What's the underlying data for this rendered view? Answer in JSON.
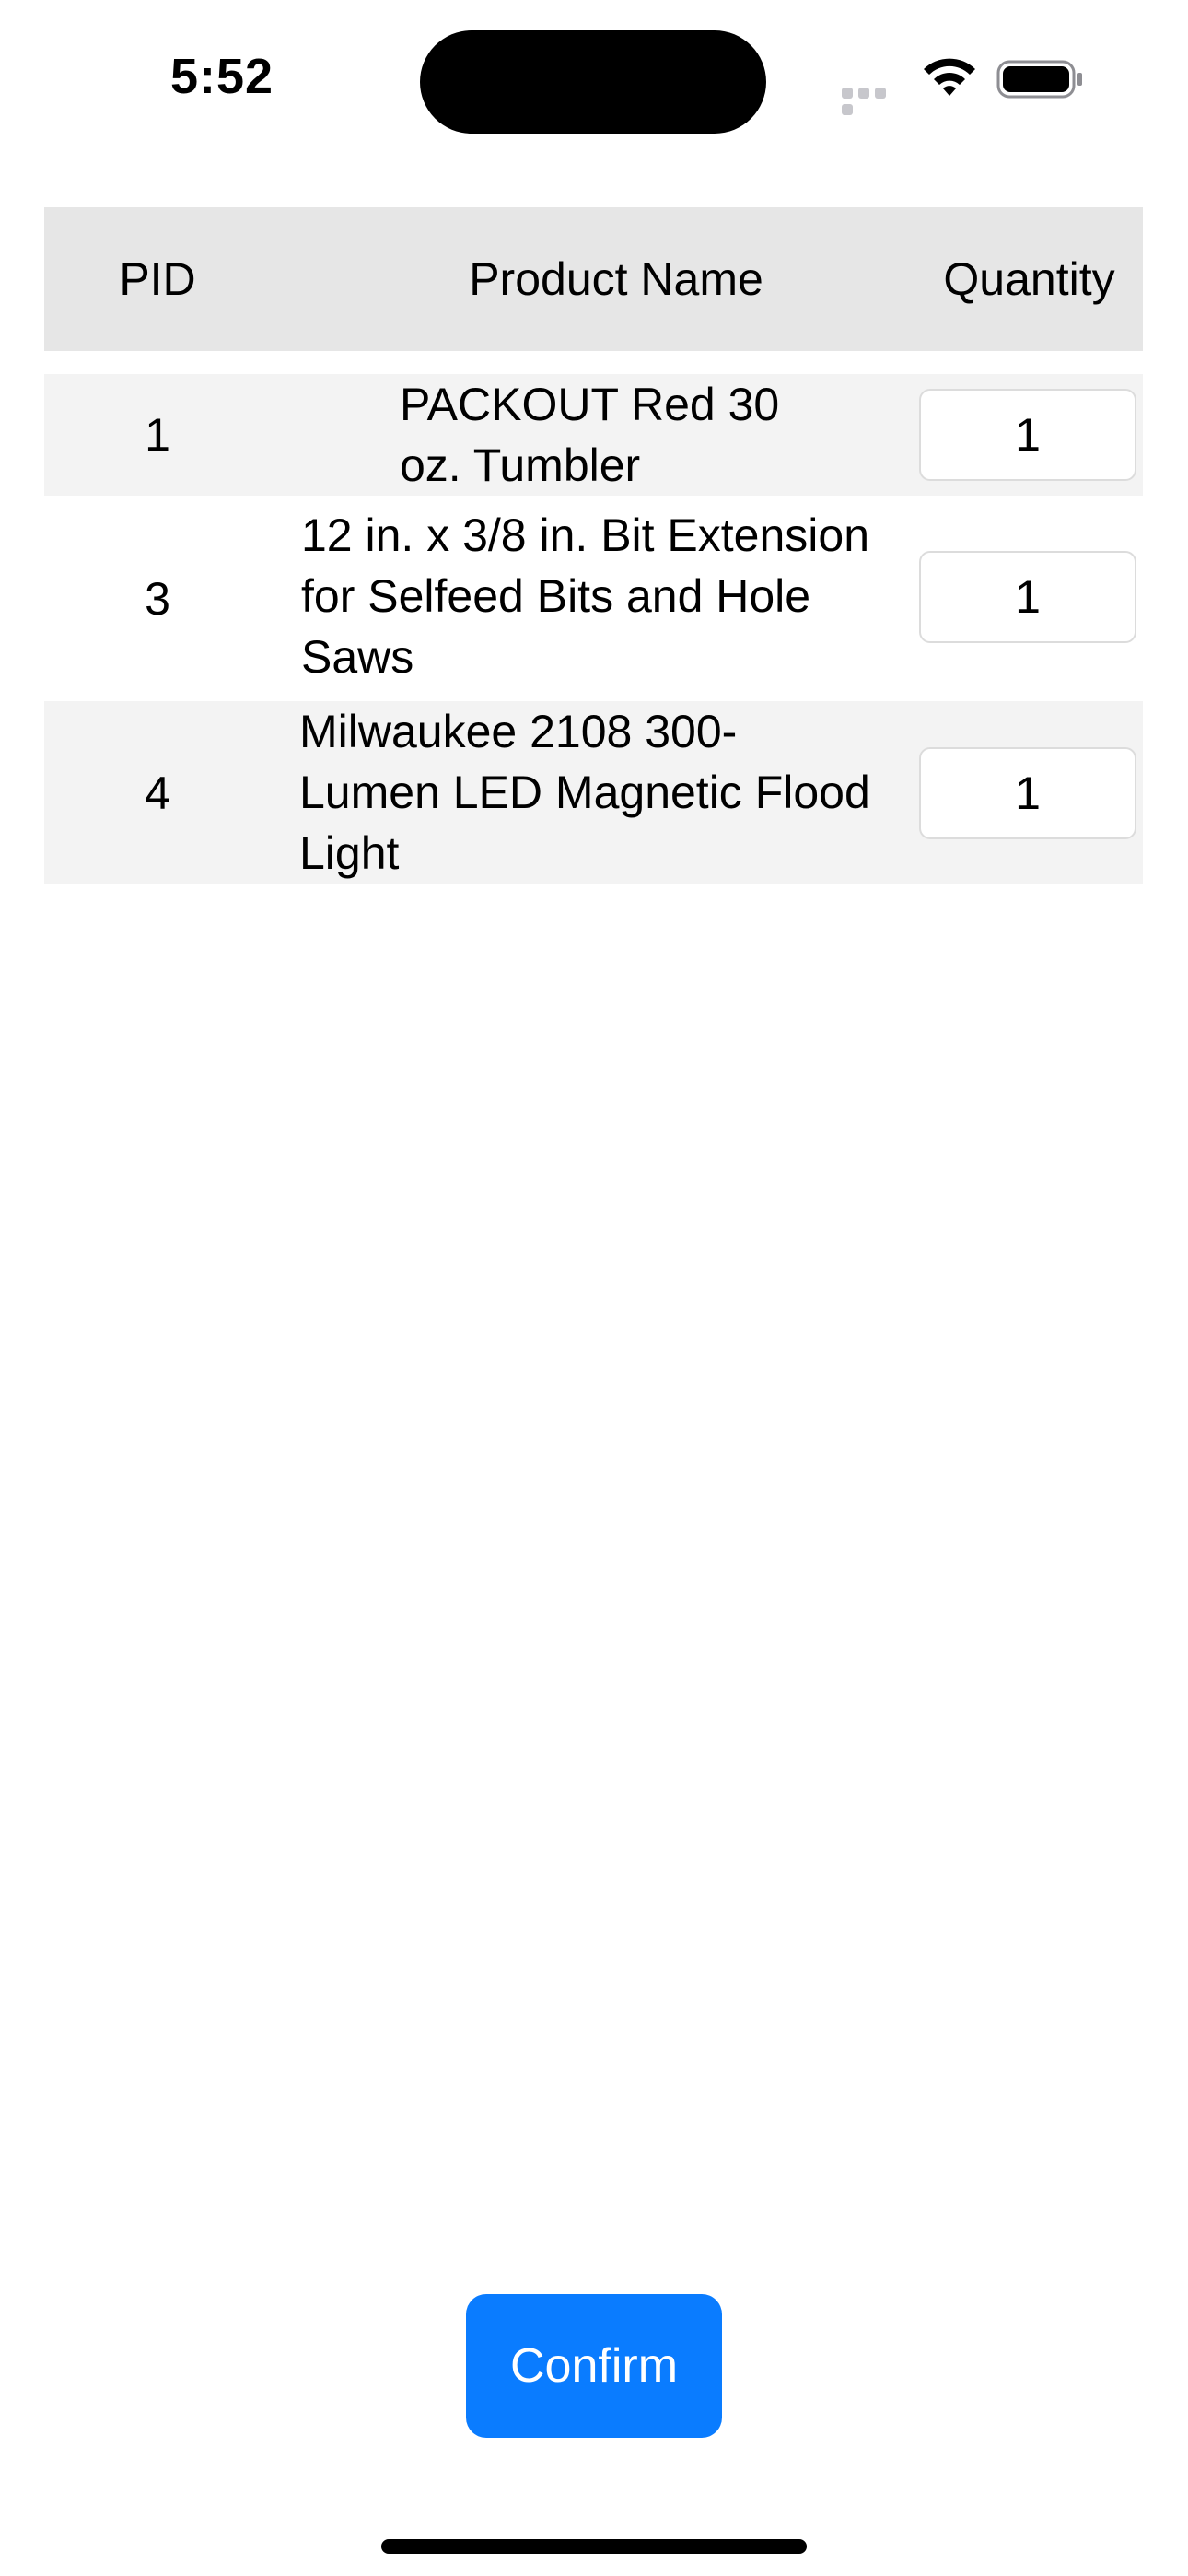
{
  "status_bar": {
    "time": "5:52",
    "icons": [
      "signal-icon",
      "wifi-icon",
      "battery-icon"
    ]
  },
  "table": {
    "headers": {
      "pid": "PID",
      "name": "Product Name",
      "quantity": "Quantity"
    },
    "rows": [
      {
        "pid": "1",
        "name": "PACKOUT Red 30\noz. Tumbler",
        "quantity": "1"
      },
      {
        "pid": "3",
        "name": "12 in. x 3/8 in. Bit Extension\nfor Selfeed Bits and Hole\nSaws",
        "quantity": "1"
      },
      {
        "pid": "4",
        "name": "Milwaukee 2108 300-\nLumen LED Magnetic Flood\nLight",
        "quantity": "1"
      }
    ]
  },
  "confirm_button": {
    "label": "Confirm"
  },
  "colors": {
    "accent": "#0a7cff",
    "header_bg": "#e6e6e6",
    "row_alt_bg": "#f3f3f3"
  }
}
